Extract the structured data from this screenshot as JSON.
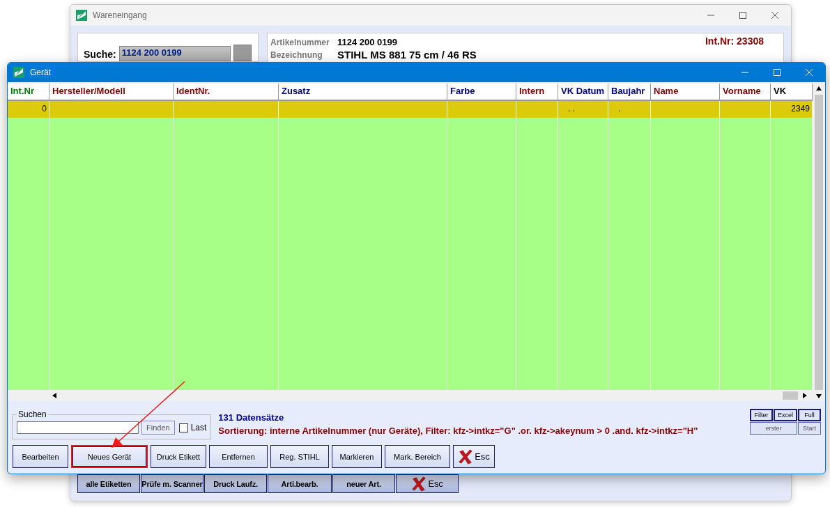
{
  "back_window": {
    "title": "Wareneingang",
    "search_label": "Suche:",
    "search_value": "1124 200 0199",
    "int_nr": "Int.Nr: 23308",
    "fields": [
      {
        "label": "Artikelnummer",
        "value": "1124 200 0199"
      },
      {
        "label": "Bezeichnung",
        "value": "STIHL MS 881 75 cm / 46 RS"
      }
    ],
    "buttons": [
      {
        "label": "alle Etiketten",
        "kind": "text"
      },
      {
        "label": "Prüfe m. Scanner",
        "kind": "text"
      },
      {
        "label": "Druck Laufz.",
        "kind": "text"
      },
      {
        "label": "Arti.bearb.",
        "kind": "text"
      },
      {
        "label": "neuer Art.",
        "kind": "text"
      },
      {
        "label": "Esc",
        "kind": "esc"
      }
    ]
  },
  "window": {
    "title": "Gerät"
  },
  "table": {
    "columns": [
      {
        "label": "Int.Nr",
        "color": "#008000"
      },
      {
        "label": "Hersteller/Modell",
        "color": "#800000"
      },
      {
        "label": "IdentNr.",
        "color": "#800000"
      },
      {
        "label": "Zusatz",
        "color": "#000080"
      },
      {
        "label": "Farbe",
        "color": "#000080"
      },
      {
        "label": "Intern",
        "color": "#800000"
      },
      {
        "label": "VK Datum",
        "color": "#000080"
      },
      {
        "label": "Baujahr",
        "color": "#000080"
      },
      {
        "label": "Name",
        "color": "#800000"
      },
      {
        "label": "Vorname",
        "color": "#800000"
      },
      {
        "label": "VK",
        "color": "#000000"
      }
    ],
    "rows": [
      {
        "selected": true,
        "cells": [
          "0",
          "",
          "",
          "",
          "",
          "",
          ". .",
          ".",
          "",
          "",
          "2349"
        ]
      }
    ]
  },
  "search": {
    "legend": "Suchen",
    "button": "Finden",
    "last_label": "Last",
    "last_checked": false
  },
  "record_count": "131 Datensätze",
  "sort_info": "Sortierung: interne Artikelnummer (nur Geräte), Filter: kfz->intkz=\"G\" .or. kfz->akeynum > 0 .and. kfz->intkz=\"H\"",
  "side_buttons": [
    {
      "label": "Filter",
      "disabled": false
    },
    {
      "label": "Excel",
      "disabled": false
    },
    {
      "label": "Full",
      "disabled": false
    },
    {
      "label": "erster",
      "disabled": true
    },
    {
      "label": "Start",
      "disabled": true
    }
  ],
  "buttons": [
    {
      "label": "Bearbeiten",
      "kind": "text",
      "highlighted": false
    },
    {
      "label": "Neues Gerät",
      "kind": "text",
      "highlighted": true
    },
    {
      "label": "Druck Etikett",
      "kind": "text",
      "highlighted": false
    },
    {
      "label": "Entfernen",
      "kind": "text",
      "highlighted": false
    },
    {
      "label": "Reg. STIHL",
      "kind": "text",
      "highlighted": false
    },
    {
      "label": "Markieren",
      "kind": "text",
      "highlighted": false
    },
    {
      "label": "Mark. Bereich",
      "kind": "text",
      "highlighted": false
    },
    {
      "label": "Esc",
      "kind": "esc",
      "highlighted": false
    }
  ]
}
